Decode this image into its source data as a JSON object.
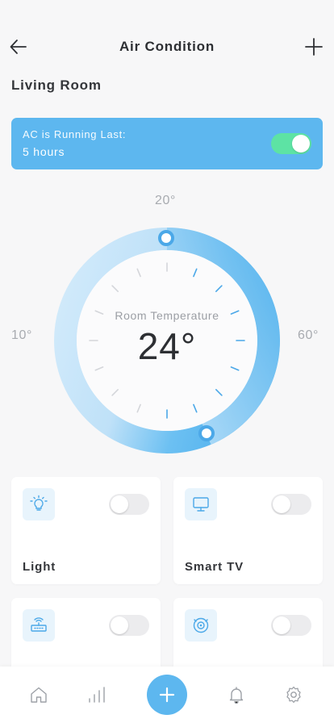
{
  "header": {
    "title": "Air Condition",
    "back_icon": "arrow-left-icon",
    "add_icon": "plus-icon"
  },
  "room": {
    "name": "Living Room"
  },
  "banner": {
    "line1": "AC is Running Last:",
    "line2": "5 hours",
    "toggle_on": true,
    "color": "#5db7ef",
    "toggle_color": "#5de3a4"
  },
  "dial": {
    "label_top": "20°",
    "label_left": "10°",
    "label_right": "60°",
    "subtitle": "Room Temperature",
    "temperature": "24°"
  },
  "devices": [
    {
      "name": "Light",
      "icon": "bulb-icon",
      "on": false
    },
    {
      "name": "Smart TV",
      "icon": "monitor-icon",
      "on": false
    },
    {
      "name": "",
      "icon": "router-icon",
      "on": false
    },
    {
      "name": "",
      "icon": "robot-vacuum-icon",
      "on": false
    }
  ],
  "tabbar": {
    "items": [
      "home-icon",
      "stats-icon",
      "add-icon",
      "bell-icon",
      "settings-icon"
    ],
    "accent": "#5db7ef"
  }
}
